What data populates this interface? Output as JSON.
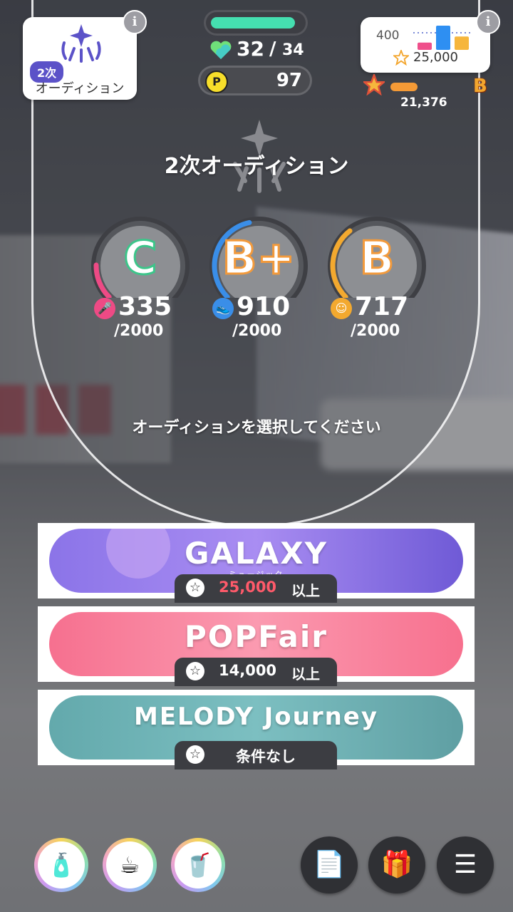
{
  "header_left": {
    "badge": "2次",
    "label": "オーディション",
    "icon": "audition-light-icon",
    "info": "i"
  },
  "stamina": {
    "current": "32",
    "separator": "/",
    "max": "34",
    "fraction": 0.94,
    "color": "#45dfb0"
  },
  "points": {
    "coin": "P",
    "value": "97"
  },
  "header_right": {
    "low_value": "400",
    "target_value": "25,000",
    "current_value": "21,376",
    "current_grade": "B",
    "progress_fraction": 0.2,
    "info": "i",
    "bar_colors": [
      "#ef4f8b",
      "#2e8ff2",
      "#f6b63c"
    ],
    "bar_levels": [
      0.3,
      1.0,
      0.55
    ]
  },
  "title": "2次オーディション",
  "stats": [
    {
      "name": "vocal",
      "icon": "microphone-icon",
      "grade": "C",
      "value": "335",
      "max": "/2000",
      "fraction": 0.17,
      "color": "#ee4a85",
      "grade_color": "#3dc58a"
    },
    {
      "name": "dance",
      "icon": "shoe-icon",
      "grade": "B+",
      "value": "910",
      "max": "/2000",
      "fraction": 0.455,
      "color": "#3a8ee8",
      "grade_color": "#f29a3c"
    },
    {
      "name": "visual",
      "icon": "face-icon",
      "grade": "B",
      "value": "717",
      "max": "/2000",
      "fraction": 0.36,
      "color": "#f3a92f",
      "grade_color": "#f29a3c"
    }
  ],
  "prompt": "オーディションを選択してください",
  "auditions": [
    {
      "logo": "GALAXY",
      "subtitle": "ミュージック",
      "requirement": "25,000",
      "unit": "以上",
      "req_color": "#ff5a6a",
      "bg": "linear-gradient(90deg,#8b74e8,#a98df2 50%,#6f5ad6)"
    },
    {
      "logo": "POPFair",
      "subtitle": "",
      "requirement": "14,000",
      "unit": "以上",
      "req_color": "#ffffff",
      "bg": "linear-gradient(90deg,#f6708f,#fb9ab0 50%,#f7708e)"
    },
    {
      "logo": "MELODY Journey",
      "subtitle": "",
      "requirement": "条件なし",
      "unit": "",
      "req_color": "#ffffff",
      "bg": "linear-gradient(90deg,#63a9ac,#7cbfc1 50%,#5f9fa3)"
    }
  ],
  "items": [
    {
      "name": "drink-bottle-item",
      "glyph": "🧴"
    },
    {
      "name": "tea-cup-item",
      "glyph": "☕"
    },
    {
      "name": "tumbler-item",
      "glyph": "🥤"
    }
  ],
  "menu": [
    {
      "name": "memo-button",
      "glyph": "📄"
    },
    {
      "name": "shop-button",
      "glyph": "🎁"
    },
    {
      "name": "menu-button",
      "glyph": "☰"
    }
  ]
}
